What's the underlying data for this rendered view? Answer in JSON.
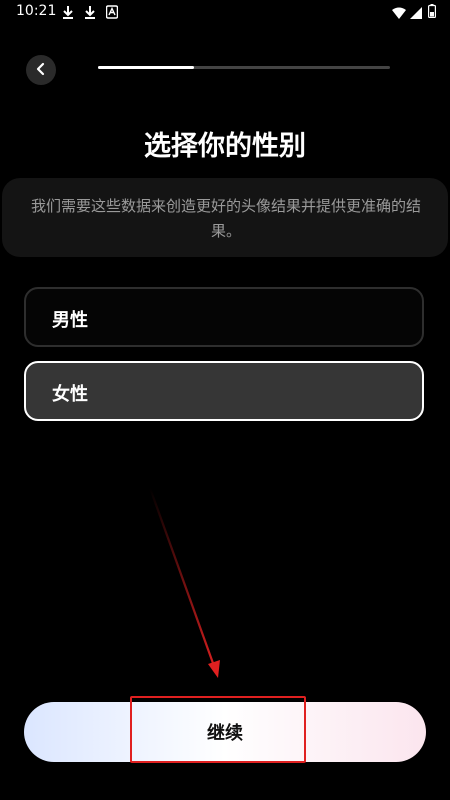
{
  "status_bar": {
    "time": "10:21",
    "icons": [
      "download-icon",
      "download-icon",
      "text-notification-icon",
      "wifi-icon",
      "signal-icon",
      "battery-icon"
    ]
  },
  "header": {
    "back_icon": "chevron-left-icon",
    "progress": 0.33
  },
  "title": "选择你的性别",
  "description": "我们需要这些数据来创造更好的头像结果并提供更准确的结果。",
  "options": [
    {
      "label": "男性",
      "selected": false
    },
    {
      "label": "女性",
      "selected": true
    }
  ],
  "continue_label": "继续",
  "colors": {
    "background": "#000000",
    "annotation": "#e02020",
    "selected_option_bg": "#363636",
    "progress_fill": "#ffffff"
  }
}
